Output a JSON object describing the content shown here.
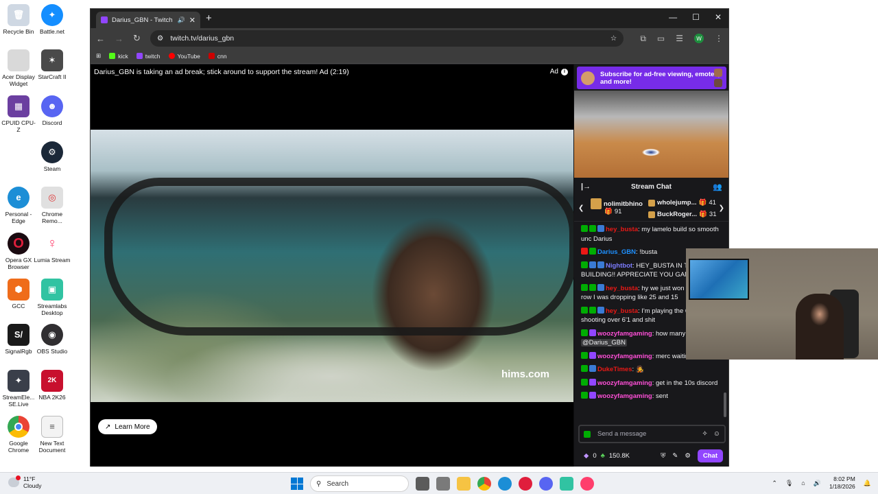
{
  "desktop_icons": [
    {
      "label": "Recycle Bin",
      "color": "#cfd8e3"
    },
    {
      "label": "Battle.net",
      "color": "#148eff"
    },
    {
      "label": "Acer Display Widget",
      "color": "#d9d9d9"
    },
    {
      "label": "StarCraft II",
      "color": "#4a4a4a"
    },
    {
      "label": "CPUID CPU-Z",
      "color": "#6b3fa0"
    },
    {
      "label": "Discord",
      "color": "#5865f2"
    },
    {
      "label": "Steam",
      "color": "#1b2838"
    },
    {
      "label": "Personal - Edge",
      "color": "#1c8ed6"
    },
    {
      "label": "Chrome Remo...",
      "color": "#e0e0e0"
    },
    {
      "label": "Opera GX Browser",
      "color": "#e01e3c"
    },
    {
      "label": "Lumia Stream",
      "color": "#ff3e6c"
    },
    {
      "label": "GCC",
      "color": "#ef6c1a"
    },
    {
      "label": "Streamlabs Desktop",
      "color": "#31c3a2"
    },
    {
      "label": "SignalRgb",
      "color": "#1a1a1a"
    },
    {
      "label": "OBS Studio",
      "color": "#302e31"
    },
    {
      "label": "StreamEle... SE.Live",
      "color": "#3a3f4a"
    },
    {
      "label": "NBA 2K26",
      "color": "#c8102e"
    },
    {
      "label": "Google Chrome",
      "color": "#4285f4"
    },
    {
      "label": "New Text Document",
      "color": "#f3f3f3"
    }
  ],
  "browser": {
    "tab_title": "Darius_GBN - Twitch",
    "url": "twitch.tv/darius_gbn",
    "profile_initial": "W",
    "bookmarks": [
      {
        "label": "kick",
        "color": "#53fc18"
      },
      {
        "label": "twitch",
        "color": "#9146ff"
      },
      {
        "label": "YouTube",
        "color": "#ff0000"
      },
      {
        "label": "cnn",
        "color": "#cc0000"
      }
    ]
  },
  "player": {
    "ad_message": "Darius_GBN is taking an ad break; stick around to support the stream! Ad (2:19)",
    "ad_tag": "Ad",
    "brand_text": "hims.com",
    "learn_more": "Learn More"
  },
  "sidebar": {
    "sub_banner": "Subscribe for ad-free viewing, emotes, and more!",
    "chat_title": "Stream Chat",
    "gifters": [
      {
        "name": "nolimitbhino",
        "count": "91"
      },
      {
        "name": "wholejump...",
        "count": "41"
      },
      {
        "name": "BuckRoger...",
        "count": "31"
      }
    ],
    "messages": [
      {
        "user": "hey_busta",
        "color": "#e91916",
        "text": ": my lamelo build so smooth unc Darius"
      },
      {
        "user": "Darius_GBN",
        "color": "#1e90ff",
        "text": ": !busta"
      },
      {
        "user": "Nightbot",
        "color": "#7c7cff",
        "text": ": HEY_BUSTA IN THE BUILDING!! APPRECIATE YOU GANG"
      },
      {
        "user": "hey_busta",
        "color": "#e91916",
        "text": ": hy we just won like 15 in a row I was dropping like 25 and 15"
      },
      {
        "user": "hey_busta",
        "color": "#e91916",
        "text": ": I'm playing the 6'7 so I'm shooting over 6'1 and shit"
      },
      {
        "user": "woozyfamgaming",
        "color": "#ff4fd8",
        "text": ": how many gifts I got",
        "mention": "@Darius_GBN"
      },
      {
        "user": "woozyfamgaming",
        "color": "#ff4fd8",
        "text": ": merc waiting"
      },
      {
        "user": "DukeTimes",
        "color": "#e91916",
        "text": ": 🧑‍🎤"
      },
      {
        "user": "woozyfamgaming",
        "color": "#ff4fd8",
        "text": ": get in the 10s discord"
      },
      {
        "user": "woozyfamgaming",
        "color": "#ff4fd8",
        "text": ": sent"
      }
    ],
    "input_placeholder": "Send a message",
    "points": "0",
    "balance": "150.8K",
    "chat_button": "Chat"
  },
  "taskbar": {
    "temperature": "11°F",
    "condition": "Cloudy",
    "search_label": "Search",
    "time": "8:02 PM",
    "date": "1/18/2026"
  }
}
